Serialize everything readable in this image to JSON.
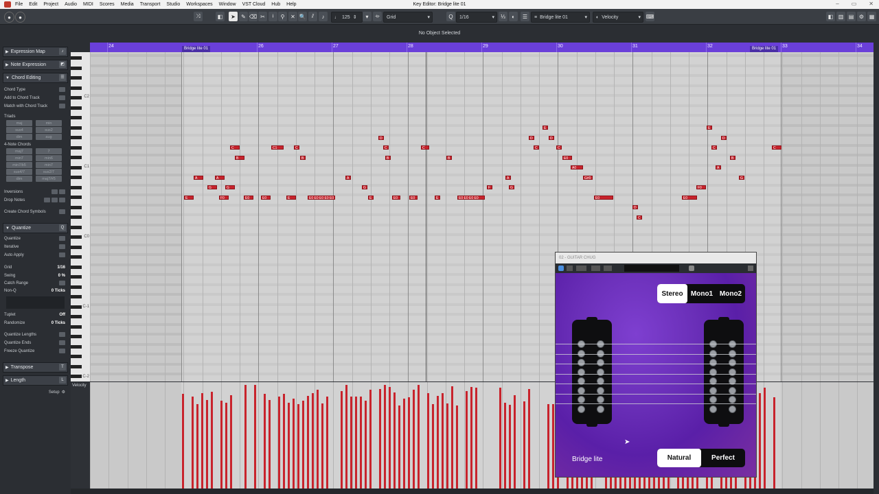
{
  "window": {
    "title": "Key Editor: Bridge lite 01",
    "controls": [
      "–",
      "▭",
      "✕"
    ]
  },
  "menu": [
    "File",
    "Edit",
    "Project",
    "Audio",
    "MIDI",
    "Scores",
    "Media",
    "Transport",
    "Studio",
    "Workspaces",
    "Window",
    "VST Cloud",
    "Hub",
    "Help"
  ],
  "toolbar": {
    "velocity_value": "125",
    "grid_type": "Grid",
    "quantize_value": "1/16",
    "part_name": "Bridge lite 01",
    "controller_lane": "Velocity"
  },
  "info_line": "No Object Selected",
  "inspector": {
    "sections": {
      "expression_map": "Expression Map",
      "note_expression": "Note Expression",
      "chord_editing": "Chord Editing",
      "quantize": "Quantize",
      "transpose": "Transpose",
      "length": "Length"
    },
    "chord_rows": [
      "Chord Type",
      "Add to Chord Track",
      "Match with Chord Track"
    ],
    "triads_label": "Triads",
    "triads": [
      "maj",
      "min",
      "sus4",
      "sus2",
      "dim",
      "aug"
    ],
    "four_note_label": "4-Note Chords",
    "four_note": [
      "maj7",
      "7",
      "min7",
      "min6",
      "min7/b5",
      "min7",
      "sus4/7",
      "sus2/7",
      "dim",
      "maj7/#5"
    ],
    "inversions": "Inversions",
    "drop_notes": "Drop Notes",
    "create_symbols": "Create Chord Symbols",
    "quantize_rows": [
      {
        "label": "Quantize",
        "value": ""
      },
      {
        "label": "Iterative",
        "value": ""
      },
      {
        "label": "Auto Apply",
        "value": ""
      },
      {
        "label": "Grid",
        "value": "1/16"
      },
      {
        "label": "Swing",
        "value": "0 %"
      },
      {
        "label": "Catch Range",
        "value": ""
      },
      {
        "label": "Non-Q",
        "value": "0 Ticks"
      },
      {
        "label": "Tuplet",
        "value": "Off"
      },
      {
        "label": "Randomize",
        "value": "0 Ticks"
      }
    ],
    "quantize_bottom": [
      "Quantize Lengths",
      "Quantize Ends",
      "Freeze Quantize"
    ],
    "setup": "Setup"
  },
  "ruler": {
    "bars": [
      "24",
      "26",
      "27",
      "28",
      "29",
      "30",
      "31",
      "32",
      "33",
      "34"
    ],
    "event_start": "Bridge lite 01",
    "event_end": "Bridge lite 01"
  },
  "keyboard_labels": [
    "C2",
    "C1",
    "C0",
    "C-1",
    "C-2"
  ],
  "velocity_label": "Velocity",
  "plugin": {
    "window_title": "02 - GUITAR CHUG",
    "channel_modes": [
      "Stereo",
      "Mono1",
      "Mono2"
    ],
    "channel_selected": "Stereo",
    "tone_modes": [
      "Natural",
      "Perfect"
    ],
    "tone_selected": "Natural",
    "preset_name": "Bridge lite"
  },
  "notes": [
    {
      "label": "E",
      "lane": 15
    },
    {
      "label": "A",
      "lane": 13
    },
    {
      "label": "G",
      "lane": 14
    },
    {
      "label": "A",
      "lane": 13
    },
    {
      "label": "G",
      "lane": 14
    },
    {
      "label": "C",
      "lane": 10
    },
    {
      "label": "B",
      "lane": 11
    },
    {
      "label": "C1",
      "lane": 10
    },
    {
      "label": "C",
      "lane": 10
    },
    {
      "label": "B",
      "lane": 11
    },
    {
      "label": "F0",
      "lane": 15
    },
    {
      "label": "E0",
      "lane": 15
    },
    {
      "label": "E0",
      "lane": 15
    },
    {
      "label": "E",
      "lane": 15
    },
    {
      "label": "E0 E0 E0 E0 E0",
      "lane": 15
    },
    {
      "label": "D",
      "lane": 9
    },
    {
      "label": "C",
      "lane": 10
    },
    {
      "label": "B",
      "lane": 11
    },
    {
      "label": "A",
      "lane": 13
    },
    {
      "label": "G",
      "lane": 14
    },
    {
      "label": "E",
      "lane": 15
    },
    {
      "label": "E0",
      "lane": 15
    },
    {
      "label": "E0",
      "lane": 15
    },
    {
      "label": "C",
      "lane": 10
    },
    {
      "label": "B",
      "lane": 11
    },
    {
      "label": "E",
      "lane": 15
    },
    {
      "label": "E0 E0 E0 E0",
      "lane": 15
    },
    {
      "label": "F",
      "lane": 14
    },
    {
      "label": "A",
      "lane": 13
    },
    {
      "label": "G",
      "lane": 14
    },
    {
      "label": "E",
      "lane": 8
    },
    {
      "label": "D",
      "lane": 9
    },
    {
      "label": "D",
      "lane": 9
    },
    {
      "label": "C",
      "lane": 10
    },
    {
      "label": "C",
      "lane": 10
    },
    {
      "label": "E0",
      "lane": 11
    },
    {
      "label": "A0",
      "lane": 12
    },
    {
      "label": "G#0",
      "lane": 13
    },
    {
      "label": "E0",
      "lane": 15
    },
    {
      "label": "D",
      "lane": 16
    },
    {
      "label": "C",
      "lane": 17
    },
    {
      "label": "E",
      "lane": 8
    },
    {
      "label": "D",
      "lane": 9
    },
    {
      "label": "C",
      "lane": 10
    },
    {
      "label": "B",
      "lane": 11
    },
    {
      "label": "A",
      "lane": 12
    },
    {
      "label": "G",
      "lane": 13
    },
    {
      "label": "F0",
      "lane": 14
    },
    {
      "label": "E0",
      "lane": 15
    },
    {
      "label": "C",
      "lane": 10
    }
  ]
}
